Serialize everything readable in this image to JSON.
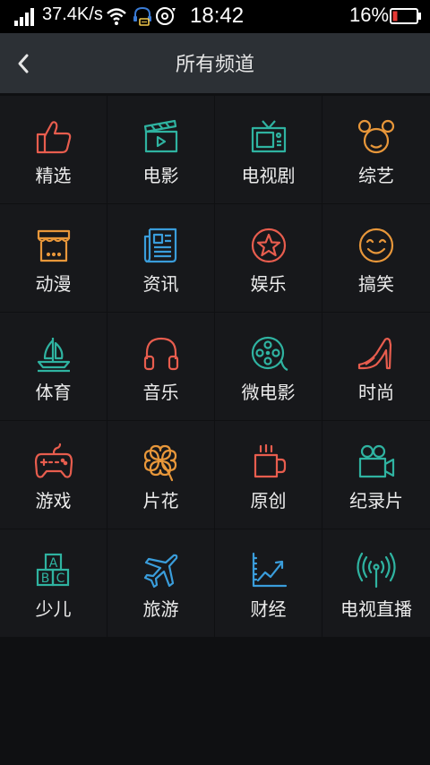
{
  "status_bar": {
    "net_speed": "37.4K/s",
    "time": "18:42",
    "battery_pct": "16%",
    "battery_color": "#e53935",
    "icons": [
      "signal-icon",
      "wifi-icon",
      "headset-notification-icon",
      "disc-icon",
      "battery-icon"
    ]
  },
  "header": {
    "title": "所有频道",
    "back_icon": "chevron-left-icon"
  },
  "channels": [
    {
      "label": "精选",
      "icon": "thumbs-up-icon",
      "color": "#e85d4e"
    },
    {
      "label": "电影",
      "icon": "clapperboard-icon",
      "color": "#2fb3a1"
    },
    {
      "label": "电视剧",
      "icon": "tv-icon",
      "color": "#2fb3a1"
    },
    {
      "label": "综艺",
      "icon": "mouse-ears-icon",
      "color": "#e8973a"
    },
    {
      "label": "动漫",
      "icon": "shop-icon",
      "color": "#e8973a"
    },
    {
      "label": "资讯",
      "icon": "newspaper-icon",
      "color": "#3a9ddb"
    },
    {
      "label": "娱乐",
      "icon": "star-circle-icon",
      "color": "#e85d4e"
    },
    {
      "label": "搞笑",
      "icon": "smiley-icon",
      "color": "#e8973a"
    },
    {
      "label": "体育",
      "icon": "sailboat-icon",
      "color": "#2fb3a1"
    },
    {
      "label": "音乐",
      "icon": "headphones-icon",
      "color": "#e85d4e"
    },
    {
      "label": "微电影",
      "icon": "film-reel-icon",
      "color": "#2fb3a1"
    },
    {
      "label": "时尚",
      "icon": "high-heel-icon",
      "color": "#e85d4e"
    },
    {
      "label": "游戏",
      "icon": "gamepad-icon",
      "color": "#e85d4e"
    },
    {
      "label": "片花",
      "icon": "clover-icon",
      "color": "#e8973a"
    },
    {
      "label": "原创",
      "icon": "coffee-cup-icon",
      "color": "#e85d4e"
    },
    {
      "label": "纪录片",
      "icon": "video-camera-icon",
      "color": "#2fb3a1"
    },
    {
      "label": "少儿",
      "icon": "abc-blocks-icon",
      "color": "#2fb3a1"
    },
    {
      "label": "旅游",
      "icon": "airplane-icon",
      "color": "#3a9ddb"
    },
    {
      "label": "财经",
      "icon": "line-chart-icon",
      "color": "#3a9ddb"
    },
    {
      "label": "电视直播",
      "icon": "broadcast-antenna-icon",
      "color": "#2fb3a1"
    }
  ],
  "abc_block_letters": [
    "A",
    "B",
    "C"
  ]
}
